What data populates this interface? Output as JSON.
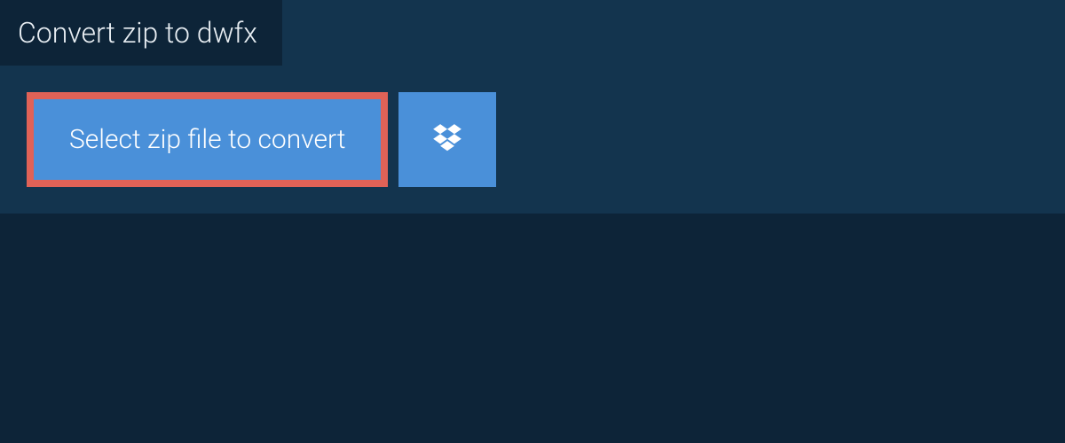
{
  "header": {
    "title": "Convert zip to dwfx"
  },
  "actions": {
    "select_label": "Select zip file to convert"
  },
  "colors": {
    "page_bg": "#0d2438",
    "panel_bg": "#13344e",
    "button_bg": "#4a90d9",
    "highlight_border": "#e06257"
  }
}
